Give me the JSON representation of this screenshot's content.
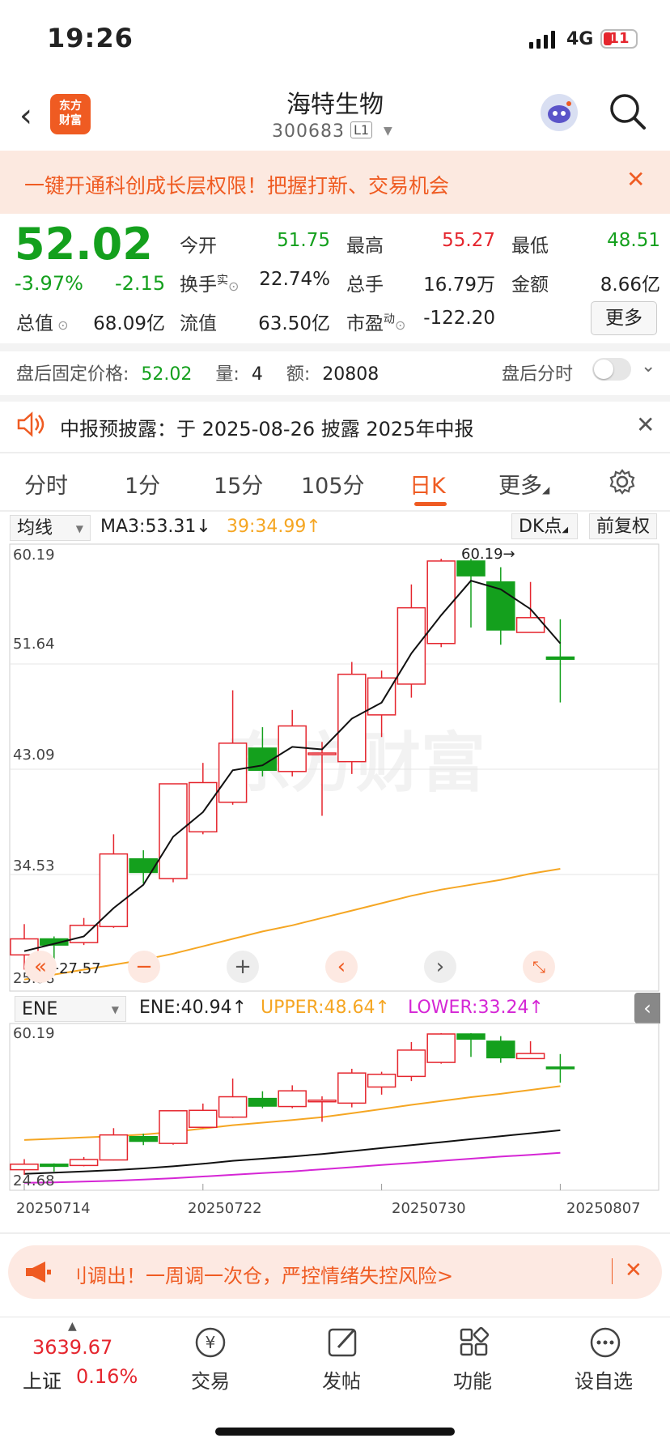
{
  "status_bar": {
    "time": "19:26",
    "network": "4G",
    "battery": "11"
  },
  "header": {
    "logo_line1": "东方",
    "logo_line2": "财富",
    "stock_name": "海特生物",
    "stock_code": "300683",
    "level": "L1"
  },
  "banner": {
    "text": "一键开通科创成长层权限！把握打新、交易机会"
  },
  "quote": {
    "price": "52.02",
    "change_pct": "-3.97%",
    "change": "-2.15",
    "open_label": "今开",
    "open": "51.75",
    "high_label": "最高",
    "high": "55.27",
    "low_label": "最低",
    "low": "48.51",
    "turnover_label": "换手",
    "turnover_sup": "实",
    "turnover": "22.74%",
    "volume_label": "总手",
    "volume": "16.79万",
    "amount_label": "金额",
    "amount": "8.66亿",
    "mktcap_label": "总值",
    "mktcap": "68.09亿",
    "float_label": "流值",
    "float": "63.50亿",
    "pe_label": "市盈",
    "pe_sup": "动",
    "pe": "-122.20",
    "more": "更多"
  },
  "after_hours": {
    "label": "盘后固定价格:",
    "price": "52.02",
    "vol_label": "量:",
    "vol": "4",
    "amt_label": "额:",
    "amt": "20808",
    "toggle_label": "盘后分时"
  },
  "notice": {
    "text": "中报预披露：于 2025-08-26 披露 2025年中报"
  },
  "tabs": [
    "分时",
    "1分",
    "15分",
    "105分",
    "日K",
    "更多"
  ],
  "main_chart": {
    "indicator_select": "均线",
    "ma3": "MA3:53.31↓",
    "ma39": "39:34.99↑",
    "dk": "DK点",
    "adjust": "前复权",
    "y_labels": [
      "60.19",
      "51.64",
      "43.09",
      "34.53",
      "25.98"
    ],
    "max_marker": "60.19",
    "min_marker": "27.57"
  },
  "sub_chart": {
    "indicator_select": "ENE",
    "ene": "ENE:40.94↑",
    "upper": "UPPER:48.64↑",
    "lower": "LOWER:33.24↑",
    "y_top": "60.19",
    "y_bottom": "24.68",
    "dates": [
      "20250714",
      "20250722",
      "20250730",
      "20250807"
    ]
  },
  "chart_data": {
    "type": "candlestick",
    "ylim": [
      25.98,
      60.19
    ],
    "candles": [
      {
        "o": 28.0,
        "c": 29.3,
        "h": 30.5,
        "l": 26.8
      },
      {
        "o": 29.3,
        "c": 28.8,
        "h": 29.5,
        "l": 27.57
      },
      {
        "o": 29.0,
        "c": 30.4,
        "h": 31.0,
        "l": 28.8
      },
      {
        "o": 30.3,
        "c": 36.2,
        "h": 37.8,
        "l": 30.2
      },
      {
        "o": 35.8,
        "c": 34.7,
        "h": 36.5,
        "l": 33.8
      },
      {
        "o": 34.2,
        "c": 41.9,
        "h": 41.9,
        "l": 33.9
      },
      {
        "o": 38.0,
        "c": 42.0,
        "h": 43.6,
        "l": 37.8
      },
      {
        "o": 40.4,
        "c": 45.2,
        "h": 49.5,
        "l": 40.2
      },
      {
        "o": 44.8,
        "c": 43.0,
        "h": 46.5,
        "l": 42.5
      },
      {
        "o": 42.9,
        "c": 46.6,
        "h": 47.9,
        "l": 42.5
      },
      {
        "o": 44.4,
        "c": 44.4,
        "h": 45.3,
        "l": 39.3
      },
      {
        "o": 43.7,
        "c": 50.8,
        "h": 51.8,
        "l": 42.7
      },
      {
        "o": 47.5,
        "c": 50.5,
        "h": 51.1,
        "l": 45.7
      },
      {
        "o": 50.0,
        "c": 56.2,
        "h": 58.1,
        "l": 48.9
      },
      {
        "o": 53.3,
        "c": 60.0,
        "h": 60.19,
        "l": 53.0
      },
      {
        "o": 60.0,
        "c": 58.8,
        "h": 60.19,
        "l": 54.6
      },
      {
        "o": 58.3,
        "c": 54.4,
        "h": 59.5,
        "l": 53.2
      },
      {
        "o": 54.2,
        "c": 55.4,
        "h": 58.3,
        "l": 54.2
      },
      {
        "o": 52.2,
        "c": 52.02,
        "h": 55.27,
        "l": 48.51
      }
    ],
    "ma3": [
      28.3,
      28.9,
      29.5,
      31.8,
      33.7,
      37.6,
      39.6,
      43.0,
      43.4,
      44.9,
      44.7,
      47.2,
      48.5,
      52.5,
      55.6,
      58.4,
      57.7,
      56.1,
      53.31
    ],
    "ma39": [
      26.0,
      26.4,
      26.8,
      27.2,
      27.6,
      28.1,
      28.7,
      29.3,
      29.9,
      30.4,
      31.0,
      31.6,
      32.2,
      32.8,
      33.3,
      33.7,
      34.1,
      34.6,
      34.99
    ],
    "ene": [
      27.0,
      27.3,
      27.6,
      27.9,
      28.3,
      28.8,
      29.4,
      30.1,
      30.6,
      31.1,
      31.7,
      32.4,
      33.1,
      33.8,
      34.5,
      35.2,
      35.9,
      36.6,
      37.3
    ],
    "upper": [
      35.0,
      35.3,
      35.6,
      35.9,
      36.3,
      36.9,
      37.7,
      38.5,
      39.1,
      39.7,
      40.4,
      41.3,
      42.3,
      43.3,
      44.2,
      45.1,
      45.9,
      46.8,
      47.7
    ],
    "lower": [
      24.9,
      25.0,
      25.2,
      25.4,
      25.7,
      26.0,
      26.4,
      26.8,
      27.2,
      27.6,
      28.1,
      28.6,
      29.1,
      29.6,
      30.1,
      30.6,
      31.1,
      31.5,
      32.0
    ],
    "sub_ylim": [
      24.68,
      60.19
    ]
  },
  "ad": {
    "text": "刂调出！一周调一次仓，严控情绪失控风险>"
  },
  "bottom_nav": {
    "index_value": "3639.67",
    "index_name": "上证",
    "index_pct": "0.16%",
    "items": [
      "交易",
      "发帖",
      "功能",
      "设自选"
    ]
  }
}
